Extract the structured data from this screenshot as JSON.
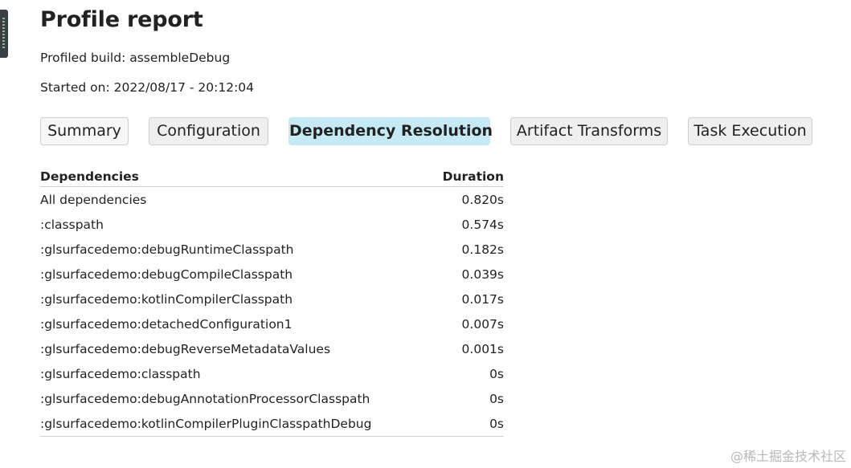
{
  "page": {
    "title": "Profile report",
    "profiled_build": "Profiled build: assembleDebug",
    "started_on": "Started on: 2022/08/17 - 20:12:04"
  },
  "tabs": [
    {
      "label": "Summary",
      "active": false
    },
    {
      "label": "Configuration",
      "active": false
    },
    {
      "label": "Dependency Resolution",
      "active": true
    },
    {
      "label": "Artifact Transforms",
      "active": false
    },
    {
      "label": "Task Execution",
      "active": false
    }
  ],
  "table": {
    "headers": {
      "dependencies": "Dependencies",
      "duration": "Duration"
    },
    "rows": [
      {
        "name": "All dependencies",
        "duration": "0.820s"
      },
      {
        "name": ":classpath",
        "duration": "0.574s"
      },
      {
        "name": ":glsurfacedemo:debugRuntimeClasspath",
        "duration": "0.182s"
      },
      {
        "name": ":glsurfacedemo:debugCompileClasspath",
        "duration": "0.039s"
      },
      {
        "name": ":glsurfacedemo:kotlinCompilerClasspath",
        "duration": "0.017s"
      },
      {
        "name": ":glsurfacedemo:detachedConfiguration1",
        "duration": "0.007s"
      },
      {
        "name": ":glsurfacedemo:debugReverseMetadataValues",
        "duration": "0.001s"
      },
      {
        "name": ":glsurfacedemo:classpath",
        "duration": "0s"
      },
      {
        "name": ":glsurfacedemo:debugAnnotationProcessorClasspath",
        "duration": "0s"
      },
      {
        "name": ":glsurfacedemo:kotlinCompilerPluginClasspathDebug",
        "duration": "0s"
      }
    ]
  },
  "watermark": "@稀土掘金技术社区",
  "colors": {
    "active_tab_bg": "#c6eaf3",
    "tab_bg": "#efefef",
    "text": "#222222"
  }
}
